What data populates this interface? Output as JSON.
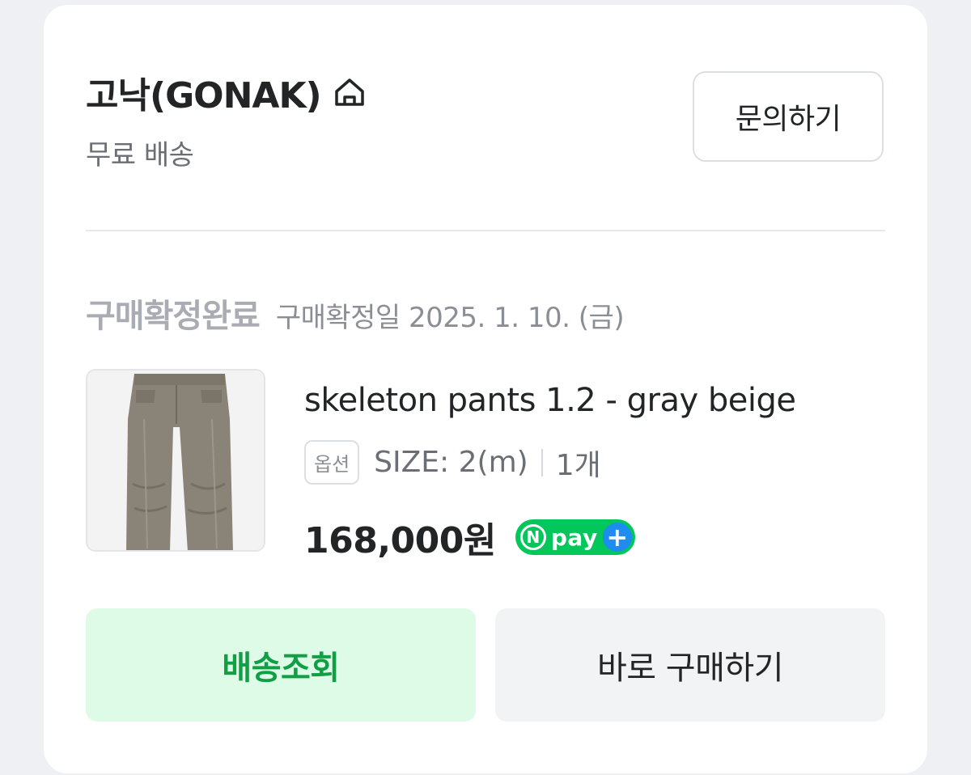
{
  "store": {
    "name": "고낙(GONAK)",
    "shipping": "무료 배송",
    "inquiry_label": "문의하기"
  },
  "order": {
    "status": "구매확정완료",
    "confirm_date": "구매확정일 2025. 1. 10. (금)"
  },
  "product": {
    "name": "skeleton pants 1.2 - gray beige",
    "option_badge": "옵션",
    "option_value": "SIZE: 2(m)",
    "quantity": "1개",
    "price": "168,000원",
    "pay_badge": {
      "n": "N",
      "text": "pay",
      "plus": "+"
    }
  },
  "actions": {
    "track_label": "배송조회",
    "buy_again_label": "바로 구매하기"
  },
  "colors": {
    "accent_green": "#109f45",
    "track_bg": "#defbe7",
    "npay_green": "#03c75a",
    "npay_blue": "#1e8cf0"
  },
  "icons": [
    "home-icon",
    "npay-logo"
  ]
}
